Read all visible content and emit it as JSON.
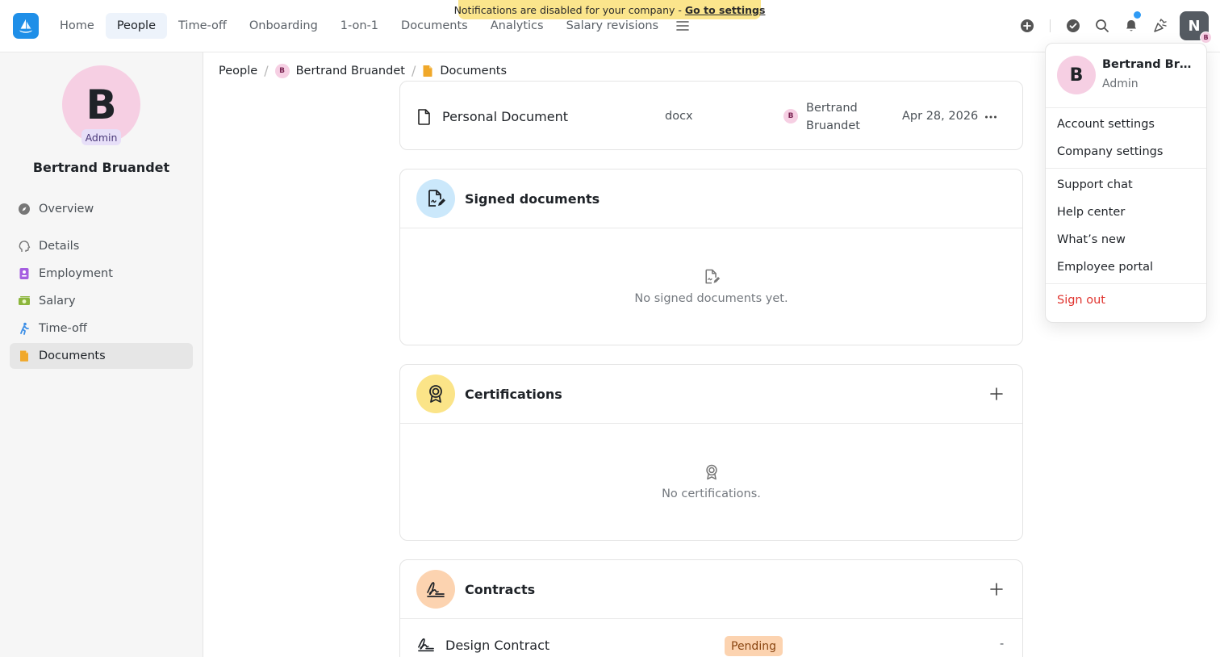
{
  "banner": {
    "text": "Notifications are disabled for your company -",
    "link": "Go to settings"
  },
  "nav": {
    "tabs": [
      "Home",
      "People",
      "Time-off",
      "Onboarding",
      "1-on-1",
      "Documents",
      "Analytics",
      "Salary revisions"
    ],
    "active_tab": "People",
    "user_initial": "N",
    "user_mini_initial": "B"
  },
  "profile": {
    "initial": "B",
    "role_badge": "Admin",
    "name": "Bertrand Bruandet"
  },
  "sidebar": {
    "items": [
      {
        "label": "Overview",
        "icon": "compass-icon"
      },
      {
        "label": "Details",
        "icon": "head-icon"
      },
      {
        "label": "Employment",
        "icon": "badge-icon"
      },
      {
        "label": "Salary",
        "icon": "money-icon"
      },
      {
        "label": "Time-off",
        "icon": "walking-icon"
      },
      {
        "label": "Documents",
        "icon": "document-icon"
      }
    ],
    "active": "Documents"
  },
  "breadcrumb": {
    "root": "People",
    "person_initial": "B",
    "person": "Bertrand Bruandet",
    "current": "Documents"
  },
  "personal_doc": {
    "name": "Personal Document",
    "type": "docx",
    "owner_initial": "B",
    "owner_first": "Bertrand",
    "owner_last": "Bruandet",
    "date": "Apr 28, 2026"
  },
  "signed": {
    "title": "Signed documents",
    "empty": "No signed documents yet."
  },
  "certifications": {
    "title": "Certifications",
    "empty": "No certifications."
  },
  "contracts": {
    "title": "Contracts",
    "row": {
      "name": "Design Contract",
      "status": "Pending",
      "value": "-"
    }
  },
  "dropdown": {
    "initial": "B",
    "name": "Bertrand Bruandet",
    "role": "Admin",
    "account_settings": "Account settings",
    "company_settings": "Company settings",
    "support_chat": "Support chat",
    "help_center": "Help center",
    "whats_new": "What’s new",
    "employee_portal": "Employee portal",
    "sign_out": "Sign out"
  },
  "colors": {
    "accent": "#1f8fe8",
    "banner": "#fbe58c",
    "danger": "#e0342f",
    "pending": "#fcd3b0"
  }
}
